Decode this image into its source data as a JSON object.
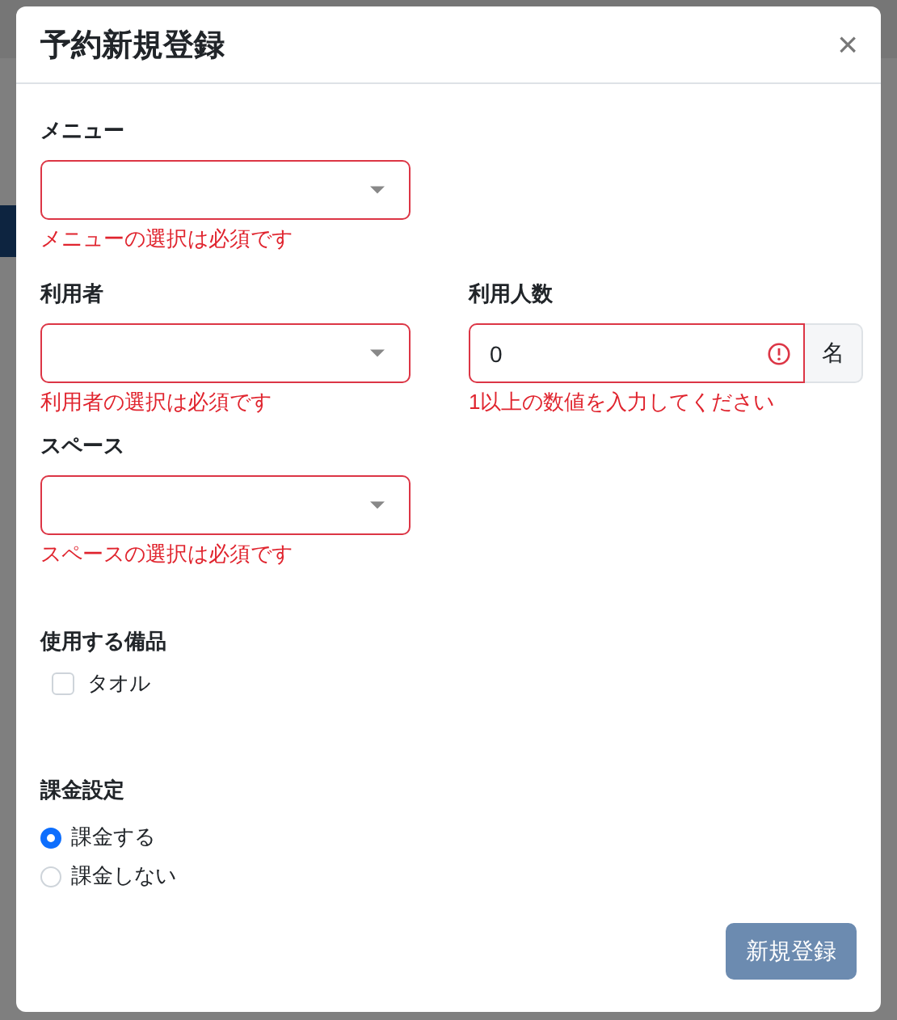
{
  "dialog": {
    "title": "予約新規登録",
    "close": "×"
  },
  "rows": [
    [
      {
        "kind": "select",
        "label": "メニュー",
        "invalid": true,
        "error": "メニューの選択は必須です"
      }
    ],
    [
      {
        "kind": "select",
        "label": "利用者",
        "invalid": true,
        "error": "利用者の選択は必須です"
      },
      {
        "kind": "number",
        "label": "利用人数",
        "value": "0",
        "unit": "名",
        "invalid": true,
        "error": "1以上の数値を入力してください"
      }
    ],
    [
      {
        "kind": "select",
        "label": "スペース",
        "invalid": true,
        "error": "スペースの選択は必須です"
      }
    ]
  ],
  "equipment": {
    "label": "使用する備品",
    "items": [
      {
        "label": "タオル",
        "checked": false
      }
    ]
  },
  "billing": {
    "label": "課金設定",
    "options": [
      {
        "label": "課金する",
        "selected": true
      },
      {
        "label": "課金しない",
        "selected": false
      }
    ]
  },
  "submit": {
    "label": "新規登録",
    "disabled": true
  }
}
